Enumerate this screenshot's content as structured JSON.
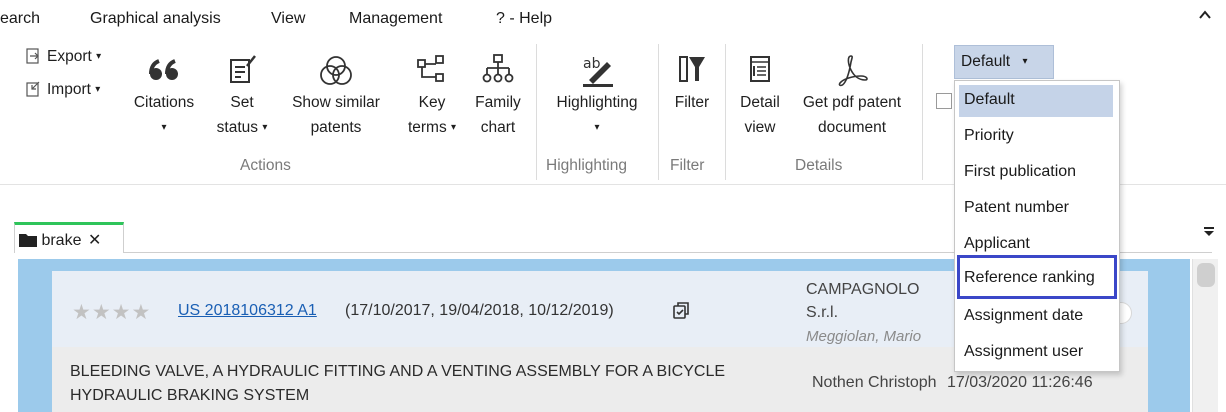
{
  "menu": {
    "items": [
      "earch",
      "Graphical analysis",
      "View",
      "Management",
      "? - Help"
    ],
    "collapse_icon": "chevron-up-icon"
  },
  "ribbon": {
    "export_label": "Export",
    "import_label": "Import",
    "citations_label": "Citations",
    "set_status_label_1": "Set",
    "set_status_label_2": "status",
    "show_similar_label_1": "Show similar",
    "show_similar_label_2": "patents",
    "key_terms_label_1": "Key",
    "key_terms_label_2": "terms",
    "family_chart_label_1": "Family",
    "family_chart_label_2": "chart",
    "highlighting_label": "Highlighting",
    "filter_label": "Filter",
    "detail_view_label_1": "Detail",
    "detail_view_label_2": "view",
    "get_pdf_label_1": "Get pdf patent",
    "get_pdf_label_2": "document",
    "groups": {
      "actions": "Actions",
      "highlighting": "Highlighting",
      "filter": "Filter",
      "details": "Details"
    }
  },
  "sort": {
    "selected": "Default",
    "options": [
      "Default",
      "Priority",
      "First publication",
      "Patent number",
      "Applicant",
      "Reference ranking",
      "Assignment date",
      "Assignment user"
    ],
    "highlighted_index": 0,
    "focused_index": 5,
    "focus_color": "#3b47c8"
  },
  "tabs": {
    "items": [
      {
        "label": "brake",
        "close": "✕"
      }
    ],
    "menu_icon": "overflow-menu-icon",
    "active_color": "#2ec45a"
  },
  "result": {
    "stars": "★★★★",
    "patent_number": "US 2018106312 A1",
    "dates": "(17/10/2017, 19/04/2018, 10/12/2019)",
    "applicant_line1": "CAMPAGNOLO",
    "applicant_line2": "S.r.l.",
    "inventor": "Meggiolan, Mario",
    "title": "BLEEDING VALVE, A HYDRAULIC FITTING AND A VENTING ASSEMBLY FOR A BICYCLE HYDRAULIC BRAKING SYSTEM",
    "assignee": "Nothen Christoph",
    "assigned_at": "17/03/2020 11:26:46",
    "link_color": "#1a5fb4",
    "panel_color": "#9ccaeb"
  }
}
